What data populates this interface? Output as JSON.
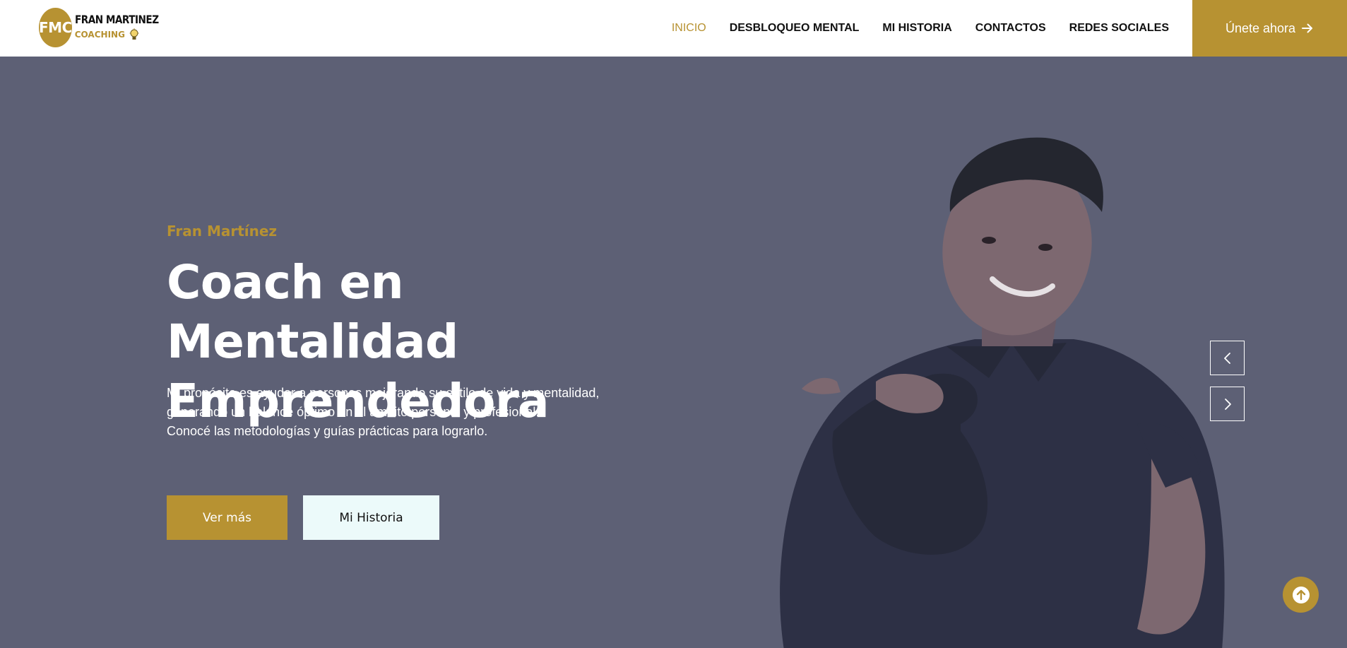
{
  "brand": {
    "logo_initials": "FMC",
    "logo_name": "FRAN MARTINEZ",
    "logo_sub": "COACHING",
    "accent_color": "#b79232"
  },
  "nav": {
    "items": [
      {
        "label": "INICIO",
        "active": true
      },
      {
        "label": "DESBLOQUEO MENTAL",
        "active": false
      },
      {
        "label": "MI HISTORIA",
        "active": false
      },
      {
        "label": "CONTACTOS",
        "active": false
      },
      {
        "label": "REDES SOCIALES",
        "active": false
      }
    ],
    "cta_label": "Únete ahora",
    "cta_icon": "arrow-right-icon"
  },
  "hero": {
    "eyebrow": "Fran Martínez",
    "title": "Coach en Mentalidad Emprendedora",
    "description_lines": [
      "Mi propósito es ayudar a personas mejorando su estilo de vida y mentalidad,",
      "generando un balance óptimo en el ámbito personal y profesional.",
      "Conocé las metodologías y guías prácticas para lograrlo."
    ],
    "primary_button": "Ver más",
    "secondary_button": "Mi Historia",
    "overlay_color": "#5d6075"
  },
  "slider": {
    "prev_icon": "chevron-left-icon",
    "next_icon": "chevron-right-icon"
  },
  "scroll_top_icon": "arrow-up-circle-icon"
}
